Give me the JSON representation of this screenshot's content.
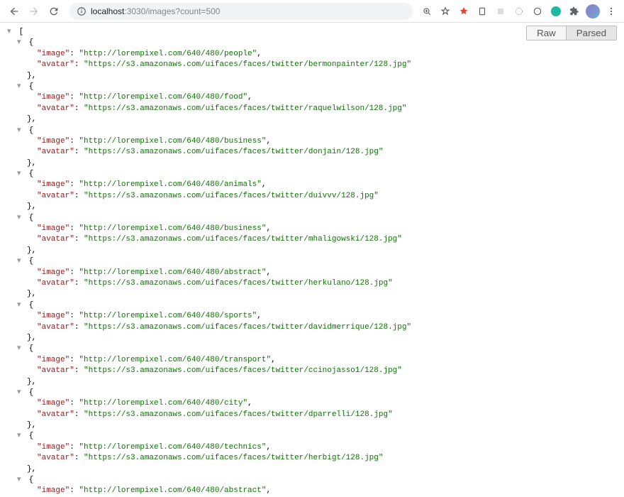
{
  "toolbar": {
    "url_host": "localhost",
    "url_port": ":3030",
    "url_path": "/images?count=500"
  },
  "tabs": {
    "raw": "Raw",
    "parsed": "Parsed"
  },
  "json": {
    "items": [
      {
        "image": "http://lorempixel.com/640/480/people",
        "avatar": "https://s3.amazonaws.com/uifaces/faces/twitter/bermonpainter/128.jpg"
      },
      {
        "image": "http://lorempixel.com/640/480/food",
        "avatar": "https://s3.amazonaws.com/uifaces/faces/twitter/raquelwilson/128.jpg"
      },
      {
        "image": "http://lorempixel.com/640/480/business",
        "avatar": "https://s3.amazonaws.com/uifaces/faces/twitter/donjain/128.jpg"
      },
      {
        "image": "http://lorempixel.com/640/480/animals",
        "avatar": "https://s3.amazonaws.com/uifaces/faces/twitter/duivvv/128.jpg"
      },
      {
        "image": "http://lorempixel.com/640/480/business",
        "avatar": "https://s3.amazonaws.com/uifaces/faces/twitter/mhaligowski/128.jpg"
      },
      {
        "image": "http://lorempixel.com/640/480/abstract",
        "avatar": "https://s3.amazonaws.com/uifaces/faces/twitter/herkulano/128.jpg"
      },
      {
        "image": "http://lorempixel.com/640/480/sports",
        "avatar": "https://s3.amazonaws.com/uifaces/faces/twitter/davidmerrique/128.jpg"
      },
      {
        "image": "http://lorempixel.com/640/480/transport",
        "avatar": "https://s3.amazonaws.com/uifaces/faces/twitter/ccinojasso1/128.jpg"
      },
      {
        "image": "http://lorempixel.com/640/480/city",
        "avatar": "https://s3.amazonaws.com/uifaces/faces/twitter/dparrelli/128.jpg"
      },
      {
        "image": "http://lorempixel.com/640/480/technics",
        "avatar": "https://s3.amazonaws.com/uifaces/faces/twitter/herbigt/128.jpg"
      },
      {
        "image": "http://lorempixel.com/640/480/abstract",
        "avatar": ""
      }
    ],
    "key_image": "image",
    "key_avatar": "avatar"
  }
}
